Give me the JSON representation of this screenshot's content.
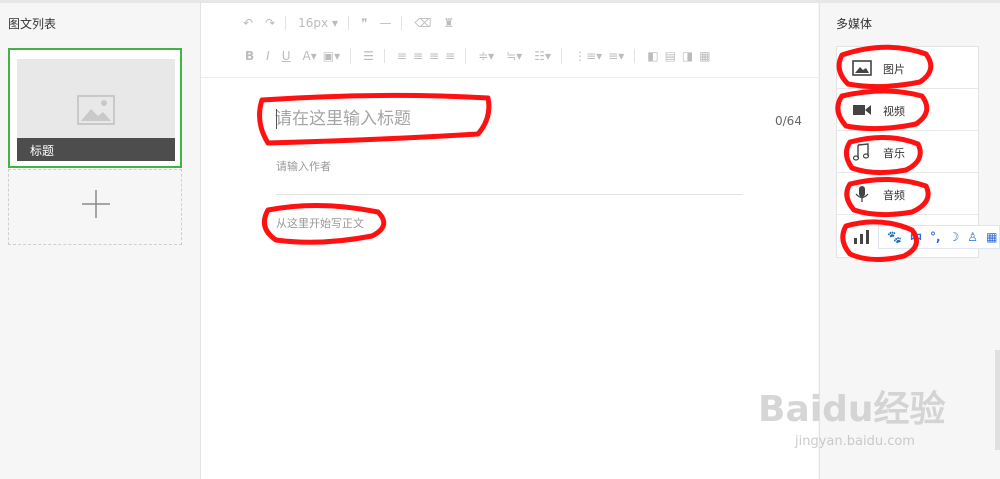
{
  "left_panel": {
    "title": "图文列表",
    "card": {
      "title": "标题"
    }
  },
  "editor": {
    "toolbar_row1": {
      "font_size": "16px",
      "quote": "❞",
      "hr": "—"
    },
    "title_placeholder": "请在这里输入标题",
    "title_count": "0/64",
    "author_placeholder": "请输入作者",
    "body_placeholder": "从这里开始写正文"
  },
  "right_panel": {
    "title": "多媒体",
    "items": [
      {
        "label": "图片",
        "icon": "image-icon"
      },
      {
        "label": "视频",
        "icon": "video-icon"
      },
      {
        "label": "音乐",
        "icon": "music-icon"
      },
      {
        "label": "音频",
        "icon": "audio-icon"
      },
      {
        "label": "",
        "icon": "vote-icon"
      }
    ]
  },
  "ime": {
    "zh": "中",
    "punct": "°,"
  },
  "watermark": {
    "logo": "Baidu经验",
    "sub": "jingyan.baidu.com"
  },
  "colors": {
    "accent": "#43b443",
    "annotation": "#ff0000",
    "ime": "#2b6cd6"
  }
}
